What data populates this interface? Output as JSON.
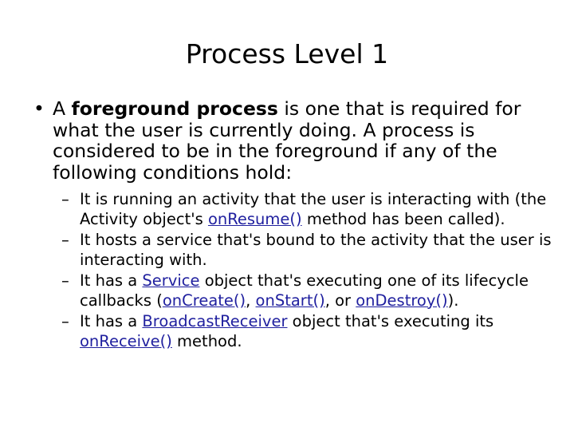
{
  "slide": {
    "title": "Process Level 1",
    "background_color": "#FFFFFF",
    "text_color": "#000000",
    "link_color": "#20209F",
    "bullets": [
      {
        "level": 1,
        "marker": "•",
        "text_parts": [
          {
            "text": "A ",
            "style": "normal"
          },
          {
            "text": "foreground process",
            "style": "bold"
          },
          {
            "text": " is one that is required for what the user is currently doing. A process is considered to be in the foreground if any of the following conditions hold:",
            "style": "normal"
          }
        ],
        "plain_text": "A foreground process is one that is required for what the user is currently doing. A process is considered to be in the foreground if any of the following conditions hold:"
      }
    ],
    "sub_bullets": [
      {
        "level": 2,
        "marker": "–",
        "parts": [
          {
            "text": "It is running an activity that the user is interacting with (the Activity object's ",
            "style": "normal"
          },
          {
            "text": "onResume()",
            "style": "link"
          },
          {
            "text": " method has been called).",
            "style": "normal"
          }
        ],
        "plain_text": "It is running an activity that the user is interacting with (the Activity object's onResume() method has been called)."
      },
      {
        "level": 2,
        "marker": "–",
        "parts": [
          {
            "text": "It hosts a service that's bound to the activity that the user is interacting with.",
            "style": "normal"
          }
        ],
        "plain_text": "It hosts a service that's bound to the activity that the user is interacting with."
      },
      {
        "level": 2,
        "marker": "–",
        "parts": [
          {
            "text": "It has a ",
            "style": "normal"
          },
          {
            "text": "Service",
            "style": "link"
          },
          {
            "text": " object that's executing one of its lifecycle callbacks (",
            "style": "normal"
          },
          {
            "text": "onCreate()",
            "style": "link"
          },
          {
            "text": ", ",
            "style": "normal"
          },
          {
            "text": "onStart()",
            "style": "link"
          },
          {
            "text": ", or ",
            "style": "normal"
          },
          {
            "text": "onDestroy()",
            "style": "link"
          },
          {
            "text": ").",
            "style": "normal"
          }
        ],
        "plain_text": "It has a Service object that's executing one of its lifecycle callbacks (onCreate(), onStart(), or onDestroy())."
      },
      {
        "level": 2,
        "marker": "–",
        "parts": [
          {
            "text": "It has a ",
            "style": "normal"
          },
          {
            "text": "BroadcastReceiver",
            "style": "link"
          },
          {
            "text": " object that's executing its ",
            "style": "normal"
          },
          {
            "text": "onReceive()",
            "style": "link"
          },
          {
            "text": " method.",
            "style": "normal"
          }
        ],
        "plain_text": "It has a BroadcastReceiver object that's executing its onReceive() method."
      }
    ]
  }
}
